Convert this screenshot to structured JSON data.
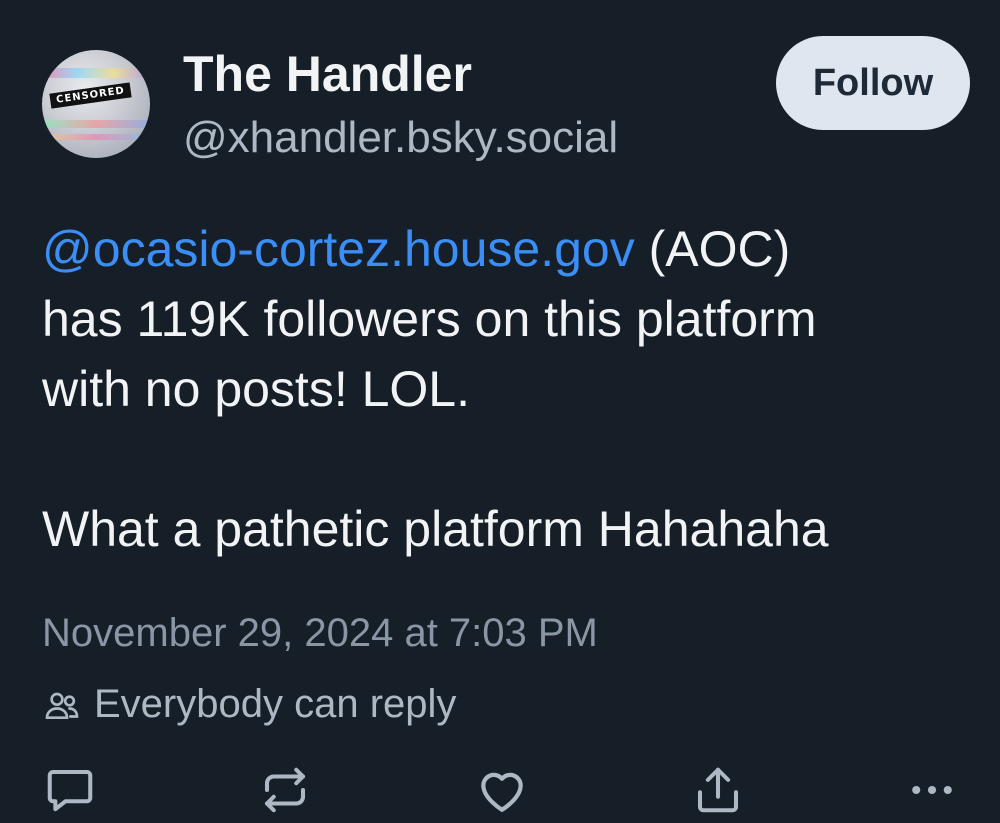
{
  "author": {
    "display_name": "The Handler",
    "handle": "@xhandler.bsky.social",
    "avatar_stamp_text": "CENSORED"
  },
  "follow_button": {
    "label": "Follow"
  },
  "post": {
    "mention": "@ocasio-cortez.house.gov",
    "line1_suffix": " (AOC)",
    "line2": "has 119K followers on this platform",
    "line3": "with no posts! LOL.",
    "line4": "What a pathetic platform Hahahaha"
  },
  "meta": {
    "timestamp": "November 29, 2024 at 7:03 PM",
    "reply_setting": "Everybody can reply"
  },
  "action_icons": [
    "reply-icon",
    "repost-icon",
    "like-icon",
    "share-icon",
    "more-icon"
  ],
  "colors": {
    "background": "#161e27",
    "mention_blue": "#3a8ef5",
    "follow_button_bg": "#e0e6ef",
    "icon_gray": "#aeb8c4"
  }
}
